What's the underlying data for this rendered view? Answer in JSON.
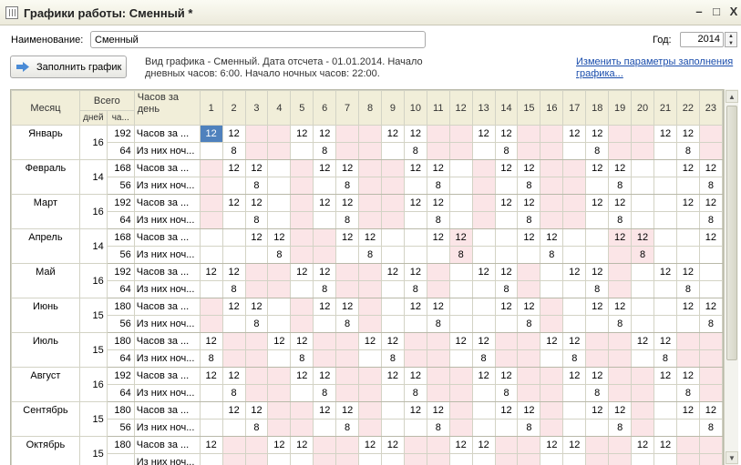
{
  "window": {
    "title": "Графики работы: Сменный *",
    "minimize": "–",
    "maximize": "□",
    "close": "X"
  },
  "form": {
    "name_label": "Наименование:",
    "name_value": "Сменный",
    "year_label": "Год:",
    "year_value": "2014",
    "fill_button": "Заполнить график",
    "info_line1": "Вид графика - Сменный. Дата отсчета - 01.01.2014. Начало",
    "info_line2": "дневных часов: 6:00. Начало ночных часов: 22:00.",
    "link_line1": "Изменить параметры заполнения",
    "link_line2": "графика..."
  },
  "grid": {
    "headers": {
      "month": "Месяц",
      "total": "Всего",
      "days": "дней",
      "hours": "ча...",
      "hours_per_day_1": "Часов за",
      "hours_per_day_2": "день"
    },
    "day_columns": [
      "1",
      "2",
      "3",
      "4",
      "5",
      "6",
      "7",
      "8",
      "9",
      "10",
      "11",
      "12",
      "13",
      "14",
      "15",
      "16",
      "17",
      "18",
      "19",
      "20",
      "21",
      "22",
      "23"
    ],
    "row_label_day": "Часов за ...",
    "row_label_night": "Из них ноч...",
    "months": [
      {
        "name": "Январь",
        "days": "16",
        "hours": "192",
        "night": "64",
        "day": [
          "12",
          "12",
          "",
          "",
          "12",
          "12",
          "",
          "",
          "12",
          "12",
          "",
          "",
          "12",
          "12",
          "",
          "",
          "12",
          "12",
          "",
          "",
          "12",
          "12",
          ""
        ],
        "ngt": [
          "",
          "8",
          "",
          "",
          "",
          "8",
          "",
          "",
          "",
          "8",
          "",
          "",
          "",
          "8",
          "",
          "",
          "",
          "8",
          "",
          "",
          "",
          "8",
          ""
        ],
        "pink": [
          0,
          0,
          1,
          1,
          0,
          0,
          1,
          1,
          0,
          0,
          1,
          1,
          0,
          0,
          1,
          1,
          0,
          0,
          1,
          1,
          0,
          0,
          1
        ]
      },
      {
        "name": "Февраль",
        "days": "14",
        "hours": "168",
        "night": "56",
        "day": [
          "",
          "12",
          "12",
          "",
          "",
          "12",
          "12",
          "",
          "",
          "12",
          "12",
          "",
          "",
          "12",
          "12",
          "",
          "",
          "12",
          "12",
          "",
          "",
          "12",
          "12"
        ],
        "ngt": [
          "",
          "",
          "8",
          "",
          "",
          "",
          "8",
          "",
          "",
          "",
          "8",
          "",
          "",
          "",
          "8",
          "",
          "",
          "",
          "8",
          "",
          "",
          "",
          "8"
        ],
        "pink": [
          1,
          0,
          0,
          0,
          1,
          0,
          0,
          1,
          1,
          0,
          0,
          0,
          1,
          0,
          0,
          1,
          1,
          0,
          0,
          0,
          0,
          0,
          0
        ]
      },
      {
        "name": "Март",
        "days": "16",
        "hours": "192",
        "night": "64",
        "day": [
          "",
          "12",
          "12",
          "",
          "",
          "12",
          "12",
          "",
          "",
          "12",
          "12",
          "",
          "",
          "12",
          "12",
          "",
          "",
          "12",
          "12",
          "",
          "",
          "12",
          "12"
        ],
        "ngt": [
          "",
          "",
          "8",
          "",
          "",
          "",
          "8",
          "",
          "",
          "",
          "8",
          "",
          "",
          "",
          "8",
          "",
          "",
          "",
          "8",
          "",
          "",
          "",
          "8"
        ],
        "pink": [
          1,
          0,
          0,
          0,
          1,
          0,
          0,
          1,
          1,
          0,
          0,
          0,
          1,
          0,
          0,
          1,
          1,
          0,
          0,
          0,
          0,
          0,
          0
        ]
      },
      {
        "name": "Апрель",
        "days": "14",
        "hours": "168",
        "night": "56",
        "day": [
          "",
          "",
          "12",
          "12",
          "",
          "",
          "12",
          "12",
          "",
          "",
          "12",
          "12",
          "",
          "",
          "12",
          "12",
          "",
          "",
          "12",
          "12",
          "",
          "",
          "12"
        ],
        "ngt": [
          "",
          "",
          "",
          "8",
          "",
          "",
          "",
          "8",
          "",
          "",
          "",
          "8",
          "",
          "",
          "",
          "8",
          "",
          "",
          "",
          "8",
          "",
          "",
          ""
        ],
        "pink": [
          0,
          0,
          0,
          0,
          1,
          1,
          0,
          0,
          0,
          0,
          0,
          1,
          0,
          0,
          0,
          0,
          0,
          0,
          1,
          1,
          0,
          0,
          0
        ]
      },
      {
        "name": "Май",
        "days": "16",
        "hours": "192",
        "night": "64",
        "day": [
          "12",
          "12",
          "",
          "",
          "12",
          "12",
          "",
          "",
          "12",
          "12",
          "",
          "",
          "12",
          "12",
          "",
          "",
          "12",
          "12",
          "",
          "",
          "12",
          "12",
          ""
        ],
        "ngt": [
          "",
          "8",
          "",
          "",
          "",
          "8",
          "",
          "",
          "",
          "8",
          "",
          "",
          "",
          "8",
          "",
          "",
          "",
          "8",
          "",
          "",
          "",
          "8",
          ""
        ],
        "pink": [
          0,
          0,
          1,
          1,
          0,
          0,
          1,
          1,
          0,
          0,
          1,
          0,
          0,
          0,
          1,
          0,
          0,
          0,
          1,
          0,
          0,
          0,
          0
        ]
      },
      {
        "name": "Июнь",
        "days": "15",
        "hours": "180",
        "night": "56",
        "day": [
          "",
          "12",
          "12",
          "",
          "",
          "12",
          "12",
          "",
          "",
          "12",
          "12",
          "",
          "",
          "12",
          "12",
          "",
          "",
          "12",
          "12",
          "",
          "",
          "12",
          "12"
        ],
        "ngt": [
          "",
          "",
          "8",
          "",
          "",
          "",
          "8",
          "",
          "",
          "",
          "8",
          "",
          "",
          "",
          "8",
          "",
          "",
          "",
          "8",
          "",
          "",
          "",
          "8"
        ],
        "pink": [
          1,
          0,
          0,
          0,
          1,
          0,
          0,
          1,
          0,
          0,
          0,
          0,
          0,
          0,
          0,
          1,
          0,
          0,
          0,
          0,
          0,
          0,
          0
        ]
      },
      {
        "name": "Июль",
        "days": "15",
        "hours": "180",
        "night": "64",
        "day": [
          "12",
          "",
          "",
          "12",
          "12",
          "",
          "",
          "12",
          "12",
          "",
          "",
          "12",
          "12",
          "",
          "",
          "12",
          "12",
          "",
          "",
          "12",
          "12",
          "",
          ""
        ],
        "ngt": [
          "8",
          "",
          "",
          "",
          "8",
          "",
          "",
          "",
          "8",
          "",
          "",
          "",
          "8",
          "",
          "",
          "",
          "8",
          "",
          "",
          "",
          "8",
          "",
          ""
        ],
        "pink": [
          0,
          1,
          1,
          0,
          0,
          1,
          1,
          0,
          0,
          1,
          1,
          0,
          0,
          1,
          1,
          0,
          0,
          1,
          1,
          0,
          0,
          1,
          1
        ]
      },
      {
        "name": "Август",
        "days": "16",
        "hours": "192",
        "night": "64",
        "day": [
          "12",
          "12",
          "",
          "",
          "12",
          "12",
          "",
          "",
          "12",
          "12",
          "",
          "",
          "12",
          "12",
          "",
          "",
          "12",
          "12",
          "",
          "",
          "12",
          "12",
          ""
        ],
        "ngt": [
          "",
          "8",
          "",
          "",
          "",
          "8",
          "",
          "",
          "",
          "8",
          "",
          "",
          "",
          "8",
          "",
          "",
          "",
          "8",
          "",
          "",
          "",
          "8",
          ""
        ],
        "pink": [
          0,
          0,
          1,
          1,
          0,
          0,
          1,
          1,
          0,
          0,
          1,
          1,
          0,
          0,
          1,
          1,
          0,
          0,
          1,
          1,
          0,
          0,
          1
        ]
      },
      {
        "name": "Сентябрь",
        "days": "15",
        "hours": "180",
        "night": "56",
        "day": [
          "",
          "12",
          "12",
          "",
          "",
          "12",
          "12",
          "",
          "",
          "12",
          "12",
          "",
          "",
          "12",
          "12",
          "",
          "",
          "12",
          "12",
          "",
          "",
          "12",
          "12"
        ],
        "ngt": [
          "",
          "",
          "8",
          "",
          "",
          "",
          "8",
          "",
          "",
          "",
          "8",
          "",
          "",
          "",
          "8",
          "",
          "",
          "",
          "8",
          "",
          "",
          "",
          "8"
        ],
        "pink": [
          0,
          0,
          0,
          1,
          1,
          0,
          0,
          1,
          0,
          0,
          0,
          1,
          0,
          0,
          0,
          1,
          0,
          0,
          0,
          1,
          0,
          0,
          0
        ]
      },
      {
        "name": "Октябрь",
        "days": "15",
        "hours": "180",
        "night": "",
        "day": [
          "12",
          "",
          "",
          "12",
          "12",
          "",
          "",
          "12",
          "12",
          "",
          "",
          "12",
          "12",
          "",
          "",
          "12",
          "12",
          "",
          "",
          "12",
          "12",
          "",
          ""
        ],
        "ngt": [
          "",
          "",
          "",
          "",
          "",
          "",
          "",
          "",
          "",
          "",
          "",
          "",
          "",
          "",
          "",
          "",
          "",
          "",
          "",
          "",
          "",
          "",
          ""
        ],
        "pink": [
          0,
          1,
          1,
          0,
          0,
          1,
          1,
          0,
          0,
          1,
          1,
          0,
          0,
          1,
          1,
          0,
          0,
          1,
          1,
          0,
          0,
          1,
          1
        ]
      }
    ]
  },
  "colors": {
    "selected_cell": "#4f81bd",
    "weekend_cell": "#fbe5e7",
    "header_bg": "#f1eed9",
    "link": "#1a4dac"
  }
}
